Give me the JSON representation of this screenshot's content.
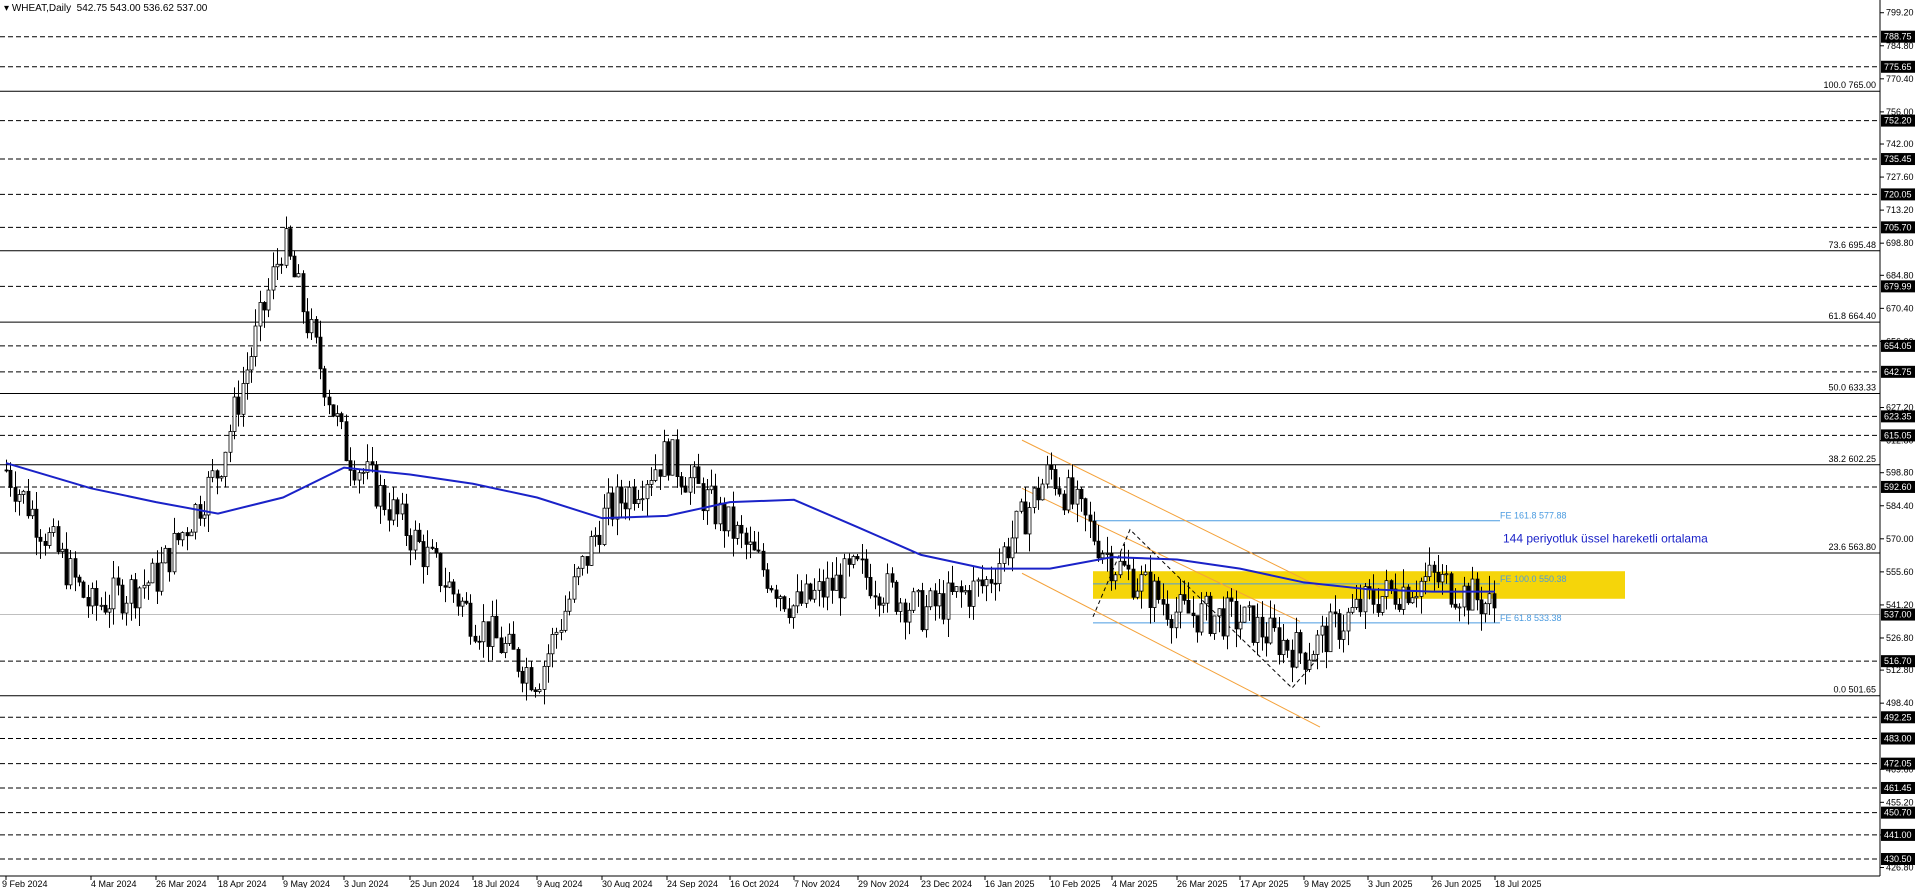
{
  "header": {
    "symbol_timeframe": "WHEAT,Daily",
    "ohlc": "542.75 543.00 536.62 537.00"
  },
  "chart_data": {
    "type": "candlestick",
    "title": "WHEAT,Daily",
    "ylim": [
      423.1,
      803.0
    ],
    "price_axis_ticks": [
      799.2,
      784.8,
      770.4,
      756.0,
      742.0,
      727.6,
      713.2,
      698.8,
      684.8,
      670.4,
      656.0,
      627.2,
      612.8,
      598.8,
      584.4,
      570.0,
      555.6,
      541.2,
      526.8,
      512.8,
      498.4,
      469.6,
      455.2,
      441.0,
      426.8
    ],
    "date_axis_labels": [
      "9 Feb 2024",
      "4 Mar 2024",
      "26 Mar 2024",
      "18 Apr 2024",
      "9 May 2024",
      "3 Jun 2024",
      "25 Jun 2024",
      "18 Jul 2024",
      "9 Aug 2024",
      "30 Aug 2024",
      "24 Sep 2024",
      "16 Oct 2024",
      "7 Nov 2024",
      "29 Nov 2024",
      "23 Dec 2024",
      "16 Jan 2025",
      "10 Feb 2025",
      "4 Mar 2025",
      "26 Mar 2025",
      "17 Apr 2025",
      "9 May 2025",
      "3 Jun 2025",
      "26 Jun 2025",
      "18 Jul 2025"
    ],
    "horizontal_levels": [
      788.75,
      775.65,
      752.2,
      735.45,
      720.05,
      705.7,
      679.99,
      654.05,
      642.75,
      623.35,
      615.05,
      592.6,
      537.0,
      516.7,
      492.25,
      483.0,
      472.05,
      461.45,
      450.7,
      441.0,
      430.5
    ],
    "fibonacci_retracement": [
      {
        "label": "100.0 765.00",
        "price": 765.0
      },
      {
        "label": "73.6 695.48",
        "price": 695.48
      },
      {
        "label": "61.8 664.40",
        "price": 664.4
      },
      {
        "label": "50.0 633.33",
        "price": 633.33
      },
      {
        "label": "38.2 602.25",
        "price": 602.25
      },
      {
        "label": "23.6 563.80",
        "price": 563.8
      },
      {
        "label": "0.0 501.65",
        "price": 501.65
      }
    ],
    "fibonacci_extension": [
      {
        "label": "FE 161.8 577.88",
        "price": 577.88
      },
      {
        "label": "FE 100.0 550.38",
        "price": 550.38
      },
      {
        "label": "FE 61.8 533.38",
        "price": 533.38
      }
    ],
    "ema_label": "144 periyotluk üssel hareketli ortalama",
    "last_price": 537.0,
    "ema_points": [
      {
        "x": "9 Feb 2024",
        "y": 603
      },
      {
        "x": "4 Mar 2024",
        "y": 592
      },
      {
        "x": "26 Mar 2024",
        "y": 586
      },
      {
        "x": "18 Apr 2024",
        "y": 581
      },
      {
        "x": "9 May 2024",
        "y": 588
      },
      {
        "x": "3 Jun 2024",
        "y": 601
      },
      {
        "x": "25 Jun 2024",
        "y": 598
      },
      {
        "x": "18 Jul 2024",
        "y": 594
      },
      {
        "x": "9 Aug 2024",
        "y": 588
      },
      {
        "x": "30 Aug 2024",
        "y": 579
      },
      {
        "x": "24 Sep 2024",
        "y": 580
      },
      {
        "x": "16 Oct 2024",
        "y": 586
      },
      {
        "x": "7 Nov 2024",
        "y": 587
      },
      {
        "x": "29 Nov 2024",
        "y": 575
      },
      {
        "x": "23 Dec 2024",
        "y": 563
      },
      {
        "x": "16 Jan 2025",
        "y": 557
      },
      {
        "x": "10 Feb 2025",
        "y": 557
      },
      {
        "x": "4 Mar 2025",
        "y": 562
      },
      {
        "x": "26 Mar 2025",
        "y": 561
      },
      {
        "x": "17 Apr 2025",
        "y": 557
      },
      {
        "x": "9 May 2025",
        "y": 551
      },
      {
        "x": "3 Jun 2025",
        "y": 548
      },
      {
        "x": "26 Jun 2025",
        "y": 547
      },
      {
        "x": "18 Jul 2025",
        "y": 547
      }
    ],
    "price_path": [
      {
        "x": "9 Feb 2024",
        "y": 600
      },
      {
        "x": "4 Mar 2024",
        "y": 540
      },
      {
        "x": "26 Mar 2024",
        "y": 553
      },
      {
        "x": "18 Apr 2024",
        "y": 600
      },
      {
        "x": "9 May 2024",
        "y": 700
      },
      {
        "x": "3 Jun 2024",
        "y": 610
      },
      {
        "x": "25 Jun 2024",
        "y": 572
      },
      {
        "x": "18 Jul 2024",
        "y": 535
      },
      {
        "x": "9 Aug 2024",
        "y": 509
      },
      {
        "x": "30 Aug 2024",
        "y": 579
      },
      {
        "x": "24 Sep 2024",
        "y": 607
      },
      {
        "x": "16 Oct 2024",
        "y": 575
      },
      {
        "x": "7 Nov 2024",
        "y": 540
      },
      {
        "x": "29 Nov 2024",
        "y": 556
      },
      {
        "x": "23 Dec 2024",
        "y": 538
      },
      {
        "x": "16 Jan 2025",
        "y": 550
      },
      {
        "x": "10 Feb 2025",
        "y": 600
      },
      {
        "x": "4 Mar 2025",
        "y": 560
      },
      {
        "x": "26 Mar 2025",
        "y": 538
      },
      {
        "x": "17 Apr 2025",
        "y": 535
      },
      {
        "x": "9 May 2025",
        "y": 520
      },
      {
        "x": "3 Jun 2025",
        "y": 543
      },
      {
        "x": "26 Jun 2025",
        "y": 553
      },
      {
        "x": "18 Jul 2025",
        "y": 540
      }
    ]
  },
  "colors": {
    "background": "#ffffff",
    "candles": "#000000",
    "ema": "#1a22c8",
    "channel": "#f4a23b",
    "fe_lines": "#4a9be0",
    "zone": "#f5d50a",
    "axis_label_bg": "#000000",
    "ema_label_text": "#1a22c8"
  }
}
